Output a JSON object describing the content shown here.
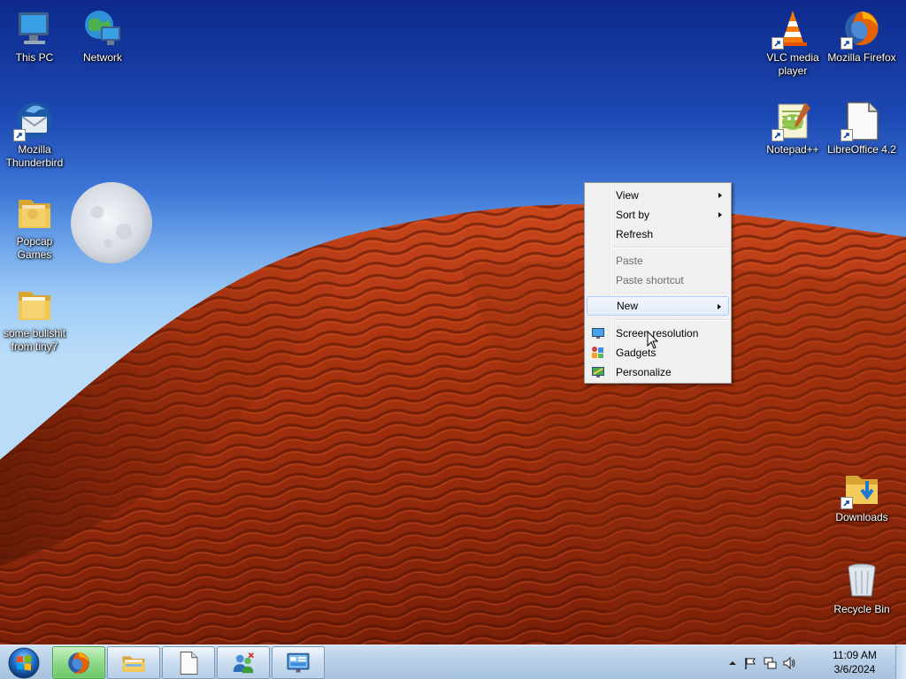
{
  "desktop": {
    "icons_left": [
      {
        "name": "this-pc",
        "label": "This PC",
        "icon": "computer-icon"
      },
      {
        "name": "network",
        "label": "Network",
        "icon": "network-globe-icon"
      },
      {
        "name": "thunderbird",
        "label": "Mozilla Thunderbird",
        "icon": "thunderbird-icon"
      },
      {
        "name": "popcap-games",
        "label": "Popcap Games",
        "icon": "folder-icon"
      },
      {
        "name": "tiny7-folder",
        "label": "some bullshit from tiny7",
        "icon": "folder-icon"
      }
    ],
    "icons_right": [
      {
        "name": "vlc",
        "label": "VLC media player",
        "icon": "vlc-cone-icon"
      },
      {
        "name": "firefox",
        "label": "Mozilla Firefox",
        "icon": "firefox-icon"
      },
      {
        "name": "notepadpp",
        "label": "Notepad++",
        "icon": "notepad-plus-plus-icon"
      },
      {
        "name": "libreoffice",
        "label": "LibreOffice 4.2",
        "icon": "document-icon"
      },
      {
        "name": "downloads",
        "label": "Downloads",
        "icon": "downloads-folder-icon"
      },
      {
        "name": "recycle-bin",
        "label": "Recycle Bin",
        "icon": "recycle-bin-icon"
      }
    ]
  },
  "context_menu": {
    "items": [
      {
        "label": "View",
        "submenu": true,
        "enabled": true
      },
      {
        "label": "Sort by",
        "submenu": true,
        "enabled": true
      },
      {
        "label": "Refresh",
        "submenu": false,
        "enabled": true
      },
      {
        "label": "Paste",
        "submenu": false,
        "enabled": false
      },
      {
        "label": "Paste shortcut",
        "submenu": false,
        "enabled": false
      },
      {
        "label": "New",
        "submenu": true,
        "enabled": true,
        "highlighted": true
      },
      {
        "label": "Screen resolution",
        "submenu": false,
        "enabled": true,
        "icon": "display-icon"
      },
      {
        "label": "Gadgets",
        "submenu": false,
        "enabled": true,
        "icon": "gadgets-icon"
      },
      {
        "label": "Personalize",
        "submenu": false,
        "enabled": true,
        "icon": "personalize-icon"
      }
    ]
  },
  "taskbar": {
    "start_icon": "windows-start-orb-icon",
    "pinned": [
      {
        "name": "firefox",
        "icon": "firefox-icon",
        "active": true
      },
      {
        "name": "explorer",
        "icon": "file-explorer-icon"
      },
      {
        "name": "document",
        "icon": "blank-document-icon"
      },
      {
        "name": "users",
        "icon": "user-accounts-icon"
      },
      {
        "name": "control-panel",
        "icon": "control-panel-icon"
      }
    ],
    "tray": {
      "icons": [
        "show-hidden-icons-chevron",
        "action-center-flag-icon",
        "network-icon",
        "volume-icon"
      ],
      "time": "11:09 AM",
      "date": "3/6/2024"
    }
  },
  "colors": {
    "sky_top": "#0d2a8c",
    "dune": "#b33a12",
    "menu_bg": "#f0f0f0",
    "taskbar": "#b9d0e8"
  }
}
